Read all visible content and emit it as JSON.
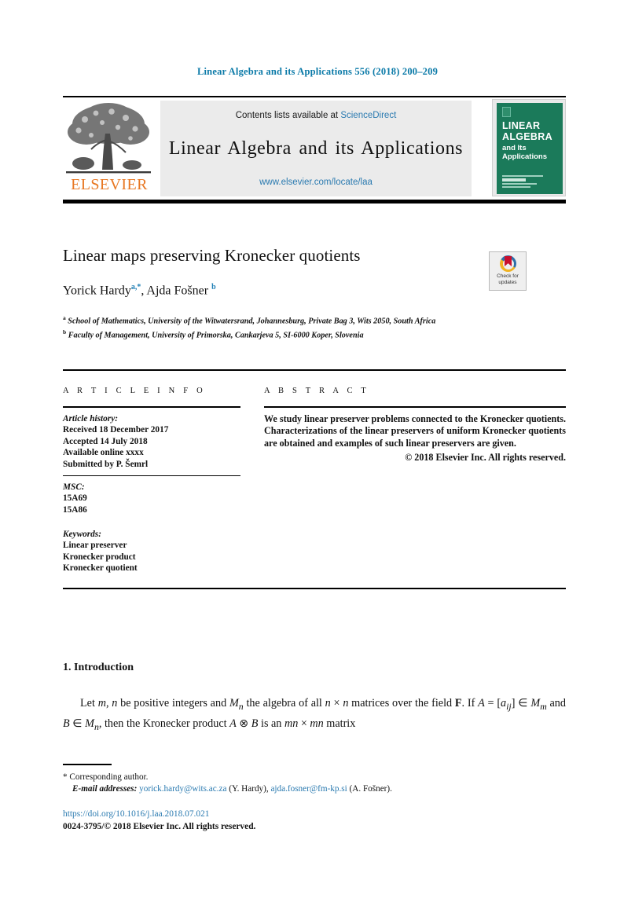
{
  "running_head": "Linear Algebra and its Applications 556 (2018) 200–209",
  "masthead": {
    "contents_prefix": "Contents lists available at ",
    "contents_link": "ScienceDirect",
    "journal_name": "Linear Algebra and its Applications",
    "journal_url": "www.elsevier.com/locate/laa",
    "publisher_wordmark": "ELSEVIER",
    "cover": {
      "line1": "LINEAR",
      "line2": "ALGEBRA",
      "line3": "and Its",
      "line4": "Applications"
    }
  },
  "article": {
    "title": "Linear maps preserving Kronecker quotients",
    "authors_html": "Yorick Hardy<sup>a,*</sup>, Ajda Fošner <sup>b</sup>",
    "affiliation_a": "School of Mathematics, University of the Witwatersrand, Johannesburg, Private Bag 3, Wits 2050, South Africa",
    "affiliation_b": "Faculty of Management, University of Primorska, Cankarjeva 5, SI-6000 Koper, Slovenia",
    "crossmark_label": "Check for updates"
  },
  "info": {
    "heading": "A R T I C L E    I N F O",
    "history_label": "Article history:",
    "received": "Received 18 December 2017",
    "accepted": "Accepted 14 July 2018",
    "available": "Available online xxxx",
    "submitted": "Submitted by P. Šemrl",
    "msc_label": "MSC:",
    "msc_codes": [
      "15A69",
      "15A86"
    ],
    "keywords_label": "Keywords:",
    "keywords": [
      "Linear preserver",
      "Kronecker product",
      "Kronecker quotient"
    ]
  },
  "abstract": {
    "heading": "A B S T R A C T",
    "body": "We study linear preserver problems connected to the Kronecker quotients. Characterizations of the linear preservers of uniform Kronecker quotients are obtained and examples of such linear preservers are given.",
    "copyright": "© 2018 Elsevier Inc. All rights reserved."
  },
  "body": {
    "section_title": "1. Introduction",
    "paragraph_html": "<span class=\"ind\">Let <i class=\"m\">m</i>, <i class=\"m\">n</i> be positive integers and <i class=\"m\">M</i><sub><i class=\"m\">n</i></sub> the algebra of all <i class=\"m\">n</i> × <i class=\"m\">n</i> matrices over the field <b>F</b>. If <i class=\"m\">A</i> = [<i class=\"m\">a<sub>ij</sub></i>] ∈ <i class=\"m\">M<sub>m</sub></i> and <i class=\"m\">B</i> ∈ <i class=\"m\">M<sub>n</sub></i>, then the Kronecker product <i class=\"m\">A</i> ⊗ <i class=\"m\">B</i> is an <i class=\"m\">mn</i> × <i class=\"m\">mn</i> matrix</span>"
  },
  "footer": {
    "corresponding": "* Corresponding author.",
    "email_label": "E-mail addresses:",
    "email_1": "yorick.hardy@wits.ac.za",
    "email_1_owner": "(Y. Hardy),",
    "email_2": "ajda.fosner@fm-kp.si",
    "email_2_owner": "(A. Fošner).",
    "doi": "https://doi.org/10.1016/j.laa.2018.07.021",
    "issn_line": "0024-3795/© 2018 Elsevier Inc. All rights reserved."
  },
  "colors": {
    "link": "#2a7ab0",
    "running_head": "#0b7aa8",
    "elsevier_orange": "#e87722",
    "cover_green": "#1b7a5a"
  }
}
